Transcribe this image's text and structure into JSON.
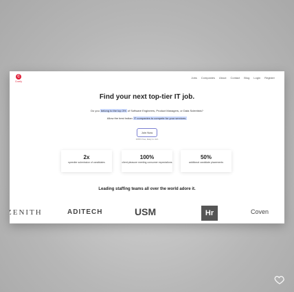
{
  "logo": {
    "text": "Cozrly"
  },
  "nav": [
    "Jobs",
    "Companies",
    "About",
    "Contact",
    "Blog",
    "Login",
    "Register"
  ],
  "hero": {
    "title": "Find your next top-tier IT job.",
    "sub1_pre": "Do you ",
    "sub1_hl": "belong to the top 3%",
    "sub1_post": " of Software Engineers, Product Managers, or Data Scientists?",
    "sub2_pre": "Allow the best Indian ",
    "sub2_hl": "IT companies to compete for your services.",
    "button": "Join Now",
    "button_sub": "100% Free, Easy to Join"
  },
  "stats": [
    {
      "value": "2x",
      "desc": "speedier submission of candidates"
    },
    {
      "value": "100%",
      "desc": "client pleasure meeting consumer expectations"
    },
    {
      "value": "50%",
      "desc": "additional candidate placements"
    }
  ],
  "leading": "Leading staffing teams all over the world adore it.",
  "brands": [
    "ZENITH",
    "ADITECH",
    "USM",
    "Hr",
    "Coven"
  ]
}
